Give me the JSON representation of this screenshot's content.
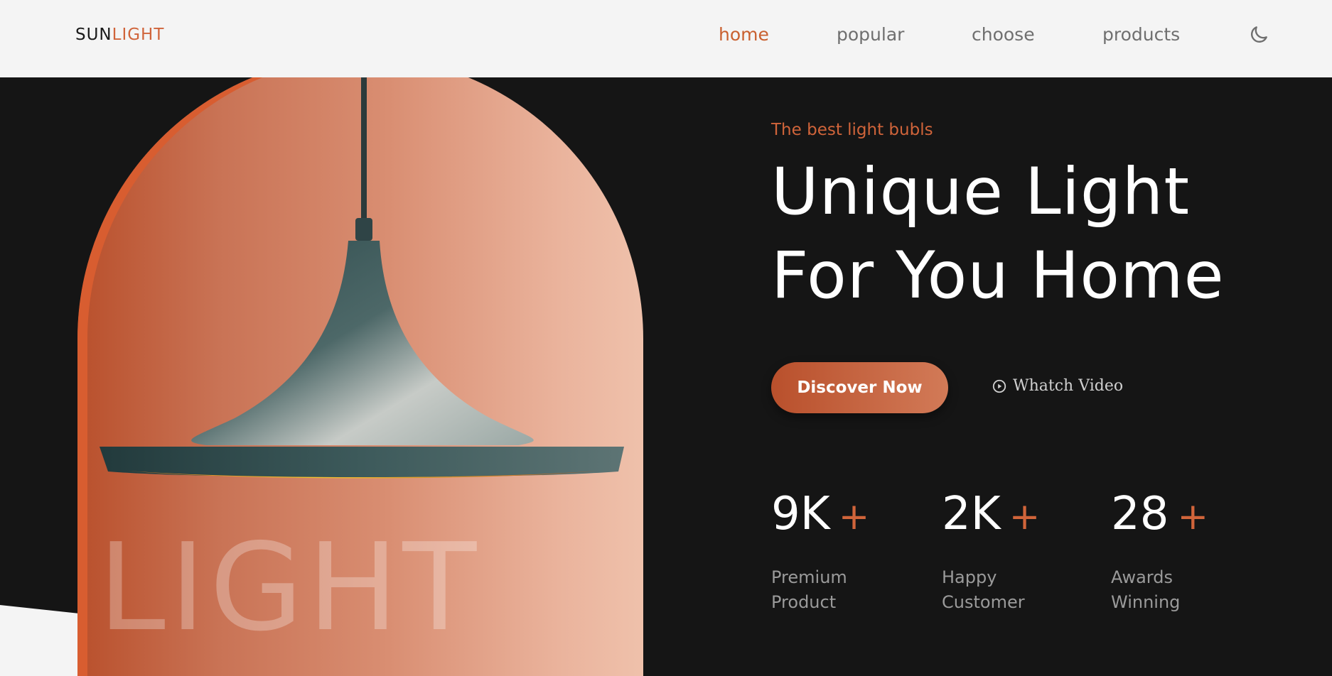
{
  "header": {
    "logo_part1": "SUN",
    "logo_part2": "LIGHT",
    "nav": [
      {
        "label": "home",
        "active": true
      },
      {
        "label": "popular",
        "active": false
      },
      {
        "label": "choose",
        "active": false
      },
      {
        "label": "products",
        "active": false
      }
    ],
    "theme_icon": "moon-icon"
  },
  "hero": {
    "tagline": "The best light bubls",
    "headline_line1": "Unique Light",
    "headline_line2": "For You Home",
    "cta_label": "Discover Now",
    "video_label": "Whatch Video",
    "video_icon": "play-circle-icon",
    "big_word": "LIGHT",
    "stats": [
      {
        "value": "9K",
        "suffix": "+",
        "label_line1": "Premium",
        "label_line2": "Product"
      },
      {
        "value": "2K",
        "suffix": "+",
        "label_line1": "Happy",
        "label_line2": "Customer"
      },
      {
        "value": "28",
        "suffix": "+",
        "label_line1": "Awards",
        "label_line2": "Winning"
      }
    ]
  },
  "colors": {
    "accent": "#d0643a",
    "background": "#151515",
    "header_bg": "#f4f4f4"
  }
}
